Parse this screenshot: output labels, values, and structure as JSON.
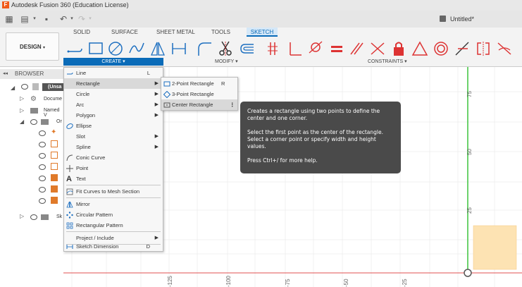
{
  "window": {
    "app_title": "Autodesk Fusion 360 (Education License)",
    "logo_letter": "F",
    "doc_title": "Untitled*"
  },
  "toolbar": {
    "tabs": [
      "SOLID",
      "SURFACE",
      "SHEET METAL",
      "TOOLS",
      "SKETCH"
    ],
    "workspace_button": "DESIGN",
    "groups": {
      "create": "CREATE",
      "modify": "MODIFY",
      "constraints": "CONSTRAINTS"
    }
  },
  "browser": {
    "header": "BROWSER",
    "items": [
      {
        "label": "(Unsa"
      },
      {
        "label": "Docume"
      },
      {
        "label": "Named V"
      },
      {
        "label": "Or"
      },
      {
        "label": "Sk"
      }
    ]
  },
  "create_menu": {
    "items": [
      {
        "label": "Line",
        "key": "L"
      },
      {
        "label": "Rectangle",
        "key": ""
      },
      {
        "label": "Circle",
        "key": ""
      },
      {
        "label": "Arc",
        "key": ""
      },
      {
        "label": "Polygon",
        "key": ""
      },
      {
        "label": "Ellipse",
        "key": ""
      },
      {
        "label": "Slot",
        "key": ""
      },
      {
        "label": "Spline",
        "key": ""
      },
      {
        "label": "Conic Curve",
        "key": ""
      },
      {
        "label": "Point",
        "key": ""
      },
      {
        "label": "Text",
        "key": ""
      },
      {
        "label": "Fit Curves to Mesh Section",
        "key": ""
      },
      {
        "label": "Mirror",
        "key": ""
      },
      {
        "label": "Circular Pattern",
        "key": ""
      },
      {
        "label": "Rectangular Pattern",
        "key": ""
      },
      {
        "label": "Project / Include",
        "key": ""
      },
      {
        "label": "Sketch Dimension",
        "key": "D"
      }
    ]
  },
  "rectangle_submenu": {
    "items": [
      {
        "label": "2-Point Rectangle",
        "key": "R"
      },
      {
        "label": "3-Point Rectangle",
        "key": ""
      },
      {
        "label": "Center Rectangle",
        "key": ""
      }
    ]
  },
  "tooltip": {
    "line1": "Creates a rectangle using two points to define the center and one corner.",
    "line2": "Select the first point as the center of the rectangle. Select a corner point or specify width and height values.",
    "line3": "Press Ctrl+/ for more help."
  },
  "ruler": {
    "y_labels": [
      "75",
      "50",
      "25"
    ],
    "x_labels": [
      "-125",
      "-100",
      "-75",
      "-50",
      "-25"
    ]
  },
  "colors": {
    "accent": "#0a6bb8",
    "axis_green": "#3cc43c",
    "axis_red": "#e05050",
    "preview_fill": "#fde3b3"
  }
}
